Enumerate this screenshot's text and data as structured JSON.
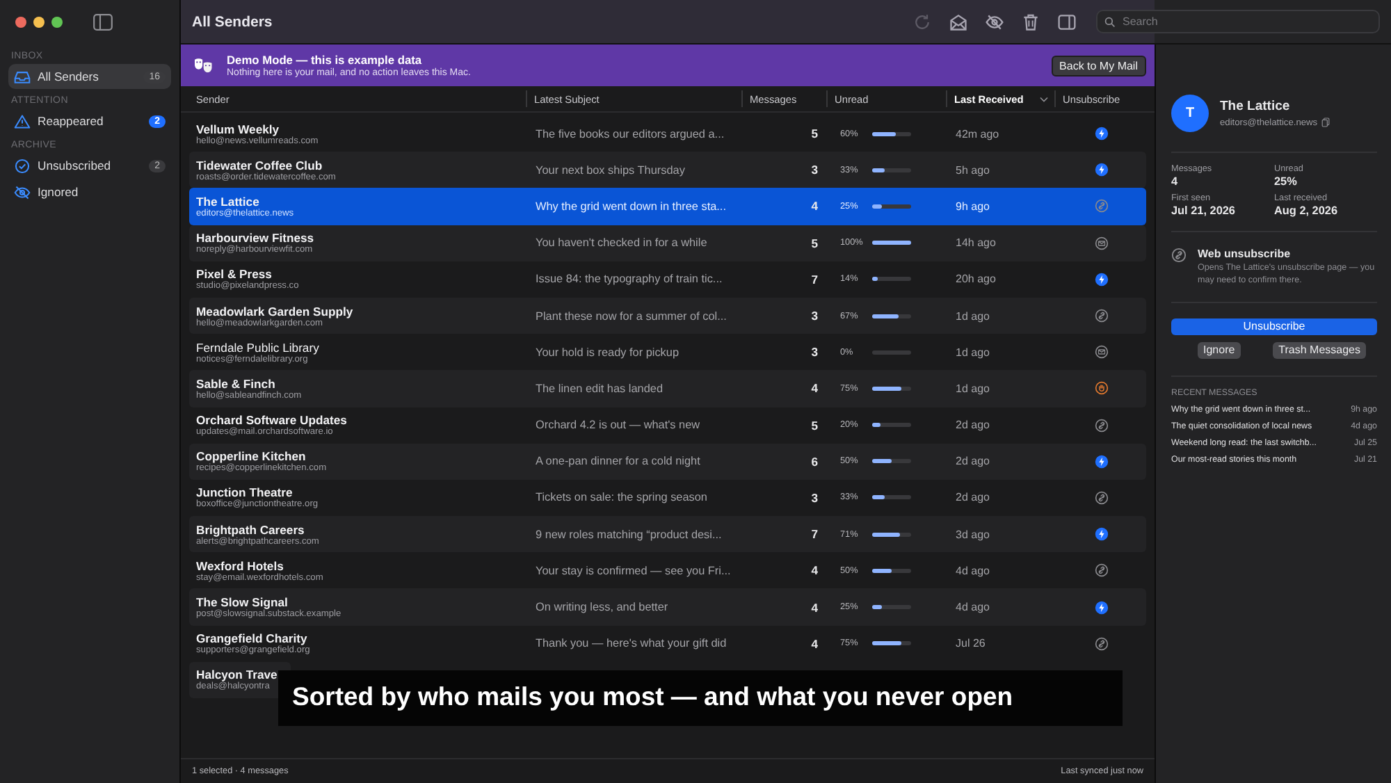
{
  "window": {
    "title": "All Senders"
  },
  "toolbar": {
    "buttons": [
      {
        "kind": "refresh",
        "disabled": true
      },
      {
        "kind": "envelope",
        "disabled": false
      },
      {
        "kind": "hide",
        "disabled": false
      },
      {
        "kind": "trash",
        "disabled": false
      },
      {
        "kind": "panel",
        "disabled": false
      }
    ],
    "search": {
      "placeholder": "Search"
    }
  },
  "sidebar": {
    "sections": [
      {
        "title": "INBOX",
        "items": [
          {
            "kind": "inbox",
            "label": "All Senders",
            "count": "16",
            "alert": false,
            "selected": true
          }
        ]
      },
      {
        "title": "ATTENTION",
        "items": [
          {
            "kind": "warning",
            "label": "Reappeared",
            "count": "2",
            "alert": true,
            "selected": false
          }
        ]
      },
      {
        "title": "ARCHIVE",
        "items": [
          {
            "kind": "check",
            "label": "Unsubscribed",
            "count": "2",
            "alert": false,
            "selected": false
          },
          {
            "kind": "hidden",
            "label": "Ignored",
            "selected": false
          }
        ]
      }
    ]
  },
  "banner": {
    "title": "Demo Mode — this is example data",
    "text": "Nothing here is your mail, and no action leaves this Mac.",
    "button": "Back to My Mail"
  },
  "table": {
    "columns": [
      {
        "label": "Sender",
        "sorted": false
      },
      {
        "label": "Latest Subject",
        "sorted": false
      },
      {
        "label": "Messages",
        "sorted": false
      },
      {
        "label": "Unread",
        "sorted": false
      },
      {
        "label": "Last Received",
        "sorted": true
      },
      {
        "label": "Unsubscribe",
        "sorted": false
      }
    ],
    "rows": [
      {
        "kind": "one-click",
        "name": "Vellum Weekly",
        "email": "hello@news.vellumreads.com",
        "subject": "The five books our editors argued a...",
        "messages": "5",
        "unread": "60%",
        "level": 0.6,
        "received": "42m ago",
        "selected": false
      },
      {
        "kind": "one-click",
        "name": "Tidewater Coffee Club",
        "email": "roasts@order.tidewatercoffee.com",
        "subject": "Your next box ships Thursday",
        "messages": "3",
        "unread": "33%",
        "level": 0.33,
        "received": "5h ago",
        "selected": false
      },
      {
        "kind": "web",
        "name": "The Lattice",
        "email": "editors@thelattice.news",
        "subject": "Why the grid went down in three sta...",
        "messages": "4",
        "unread": "25%",
        "level": 0.25,
        "received": "9h ago",
        "selected": true
      },
      {
        "kind": "email",
        "name": "Harbourview Fitness",
        "email": "noreply@harbourviewfit.com",
        "subject": "You haven't checked in for a while",
        "messages": "5",
        "unread": "100%",
        "level": 1,
        "received": "14h ago",
        "selected": false
      },
      {
        "kind": "one-click",
        "name": "Pixel & Press",
        "email": "studio@pixelandpress.co",
        "subject": "Issue 84: the typography of train tic...",
        "messages": "7",
        "unread": "14%",
        "level": 0.14,
        "received": "20h ago",
        "selected": false
      },
      {
        "kind": "web",
        "name": "Meadowlark Garden Supply",
        "email": "hello@meadowlarkgarden.com",
        "subject": "Plant these now for a summer of col...",
        "messages": "3",
        "unread": "67%",
        "level": 0.67,
        "received": "1d ago",
        "selected": false
      },
      {
        "kind": "email",
        "name": "Ferndale Public Library",
        "email": "notices@ferndalelibrary.org",
        "subject": "Your hold is ready for pickup",
        "messages": "3",
        "unread": "0%",
        "level": 0,
        "received": "1d ago",
        "selected": false
      },
      {
        "kind": "manual",
        "name": "Sable & Finch",
        "email": "hello@sableandfinch.com",
        "subject": "The linen edit has landed",
        "messages": "4",
        "unread": "75%",
        "level": 0.75,
        "received": "1d ago",
        "selected": false
      },
      {
        "kind": "web",
        "name": "Orchard Software Updates",
        "email": "updates@mail.orchardsoftware.io",
        "subject": "Orchard 4.2 is out — what's new",
        "messages": "5",
        "unread": "20%",
        "level": 0.2,
        "received": "2d ago",
        "selected": false
      },
      {
        "kind": "one-click",
        "name": "Copperline Kitchen",
        "email": "recipes@copperlinekitchen.com",
        "subject": "A one-pan dinner for a cold night",
        "messages": "6",
        "unread": "50%",
        "level": 0.5,
        "received": "2d ago",
        "selected": false
      },
      {
        "kind": "web",
        "name": "Junction Theatre",
        "email": "boxoffice@junctiontheatre.org",
        "subject": "Tickets on sale: the spring season",
        "messages": "3",
        "unread": "33%",
        "level": 0.33,
        "received": "2d ago",
        "selected": false
      },
      {
        "kind": "one-click",
        "name": "Brightpath Careers",
        "email": "alerts@brightpathcareers.com",
        "subject": "9 new roles matching “product desi...",
        "messages": "7",
        "unread": "71%",
        "level": 0.71,
        "received": "3d ago",
        "selected": false
      },
      {
        "kind": "web",
        "name": "Wexford Hotels",
        "email": "stay@email.wexfordhotels.com",
        "subject": "Your stay is confirmed — see you Fri...",
        "messages": "4",
        "unread": "50%",
        "level": 0.5,
        "received": "4d ago",
        "selected": false
      },
      {
        "kind": "one-click",
        "name": "The Slow Signal",
        "email": "post@slowsignal.substack.example",
        "subject": "On writing less, and better",
        "messages": "4",
        "unread": "25%",
        "level": 0.25,
        "received": "4d ago",
        "selected": false
      },
      {
        "kind": "web",
        "name": "Grangefield Charity",
        "email": "supporters@grangefield.org",
        "subject": "Thank you — here's what your gift did",
        "messages": "4",
        "unread": "75%",
        "level": 0.75,
        "received": "Jul 26",
        "selected": false
      },
      {
        "kind": "covered",
        "name": "Halcyon Trave",
        "email": "deals@halcyontra",
        "selected": false
      }
    ]
  },
  "status_bar": {
    "left": "1 selected · 4 messages",
    "right": "Last synced just now"
  },
  "detail": {
    "initial": "T",
    "name": "The Lattice",
    "email": "editors@thelattice.news",
    "stats": [
      {
        "label": "Messages",
        "value": "4"
      },
      {
        "label": "Unread",
        "value": "25%"
      },
      {
        "label": "First seen",
        "value": "Jul 21, 2026"
      },
      {
        "label": "Last received",
        "value": "Aug 2, 2026"
      }
    ],
    "method": {
      "kind": "web",
      "title": "Web unsubscribe",
      "text": "Opens The Lattice's unsubscribe page — you may need to confirm there."
    },
    "primary_button": "Unsubscribe",
    "buttons": [
      "Ignore",
      "Trash Messages"
    ],
    "recent_title": "RECENT MESSAGES",
    "recent": [
      {
        "subject": "Why the grid went down in three st...",
        "time": "9h ago"
      },
      {
        "subject": "The quiet consolidation of local news",
        "time": "4d ago"
      },
      {
        "subject": "Weekend long read: the last switchb...",
        "time": "Jul 25"
      },
      {
        "subject": "Our most-read stories this month",
        "time": "Jul 21"
      }
    ]
  },
  "caption": "Sorted by who mails you most — and what you never open"
}
